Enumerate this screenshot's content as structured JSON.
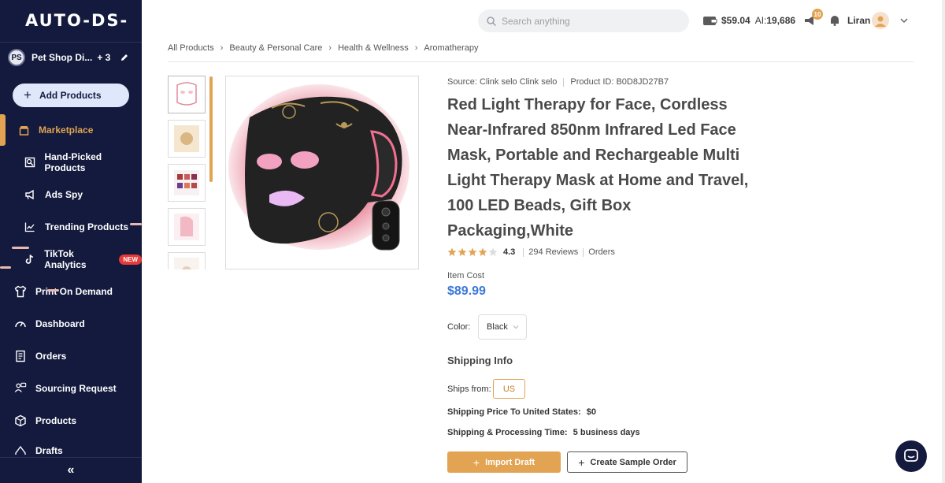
{
  "brand": {
    "logo": "AUTO-DS-"
  },
  "store": {
    "initials": "PS",
    "name": "Pet Shop Di...",
    "extra": "+ 3"
  },
  "sidebar": {
    "add_products": "Add Products",
    "items": [
      {
        "label": "Marketplace",
        "icon": "store-icon",
        "active": true
      },
      {
        "label": "Hand-Picked Products",
        "icon": "hand-picked-icon"
      },
      {
        "label": "Ads Spy",
        "icon": "megaphone-icon"
      },
      {
        "label": "Trending Products",
        "icon": "trend-chart-icon"
      },
      {
        "label": "TikTok Analytics",
        "icon": "tiktok-icon",
        "badge": "NEW"
      },
      {
        "label": "Print On Demand",
        "icon": "shirt-icon"
      },
      {
        "label": "Dashboard",
        "icon": "gauge-icon"
      },
      {
        "label": "Orders",
        "icon": "orders-icon"
      },
      {
        "label": "Sourcing Request",
        "icon": "sourcing-icon"
      },
      {
        "label": "Products",
        "icon": "box-icon"
      },
      {
        "label": "Drafts",
        "icon": "drafts-icon"
      }
    ],
    "collapse": "«"
  },
  "header": {
    "search_placeholder": "Search anything",
    "balance": "$59.04",
    "ai_label": "AI:",
    "ai_value": "19,686",
    "notifications": "10",
    "user": "Liran"
  },
  "breadcrumbs": [
    "All Products",
    "Beauty & Personal Care",
    "Health & Wellness",
    "Aromatherapy"
  ],
  "product": {
    "source_label": "Source: Clink selo Clink selo",
    "product_id_label": "Product ID: B0D8JD27B7",
    "title": "Red Light Therapy for Face, Cordless Near-Infrared 850nm Infrared Led Face Mask, Portable and Rechargeable Multi Light Therapy Mask at Home and Travel, 100 LED Beads, Gift Box Packaging,White",
    "rating": "4.3",
    "rating_stars": 4.3,
    "reviews": "294 Reviews",
    "orders": "Orders",
    "item_cost_label": "Item Cost",
    "price": "$89.99",
    "color_label": "Color:",
    "color_value": "Black",
    "shipping_heading": "Shipping Info",
    "ships_from_label": "Ships from:",
    "ships_from_value": "US",
    "shipping_price_label": "Shipping Price To United States:",
    "shipping_price_value": "$0",
    "processing_label": "Shipping & Processing Time:",
    "processing_value": "5 business days",
    "import_btn": "Import Draft",
    "sample_btn": "Create Sample Order"
  },
  "colors": {
    "sidebar": "#131a3d",
    "accent": "#e2a353",
    "price": "#3b78d8",
    "badge": "#e53a3a"
  }
}
